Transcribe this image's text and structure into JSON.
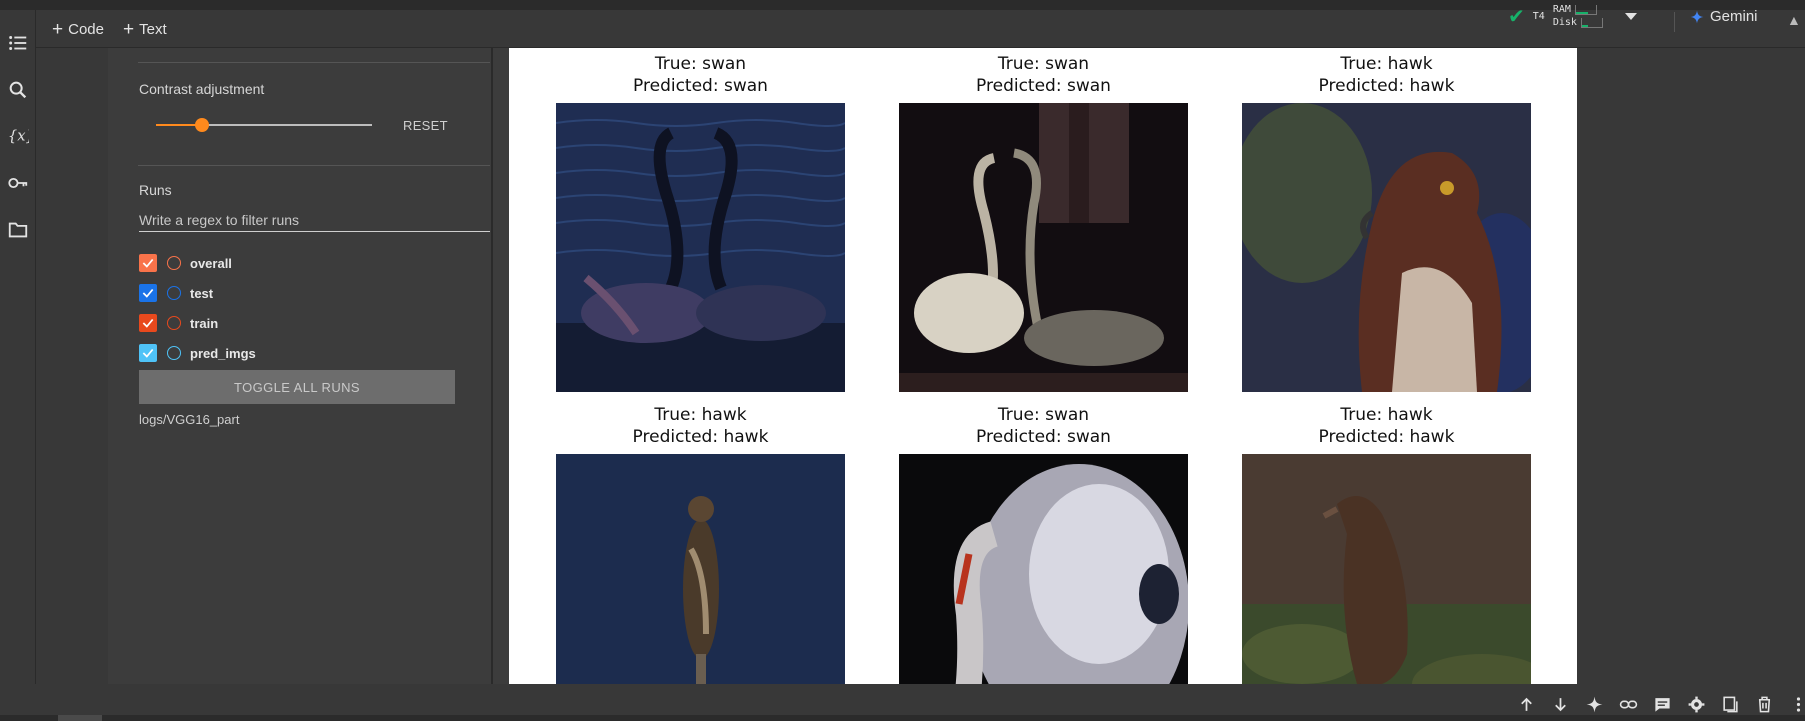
{
  "toolbar": {
    "code_label": "Code",
    "text_label": "Text",
    "gpu_label": "T4",
    "ram_label": "RAM",
    "disk_label": "Disk",
    "gemini_label": "Gemini"
  },
  "panel": {
    "contrast_label": "Contrast adjustment",
    "contrast_level": 0.2,
    "reset_label": "RESET",
    "runs_label": "Runs",
    "filter_placeholder": "Write a regex to filter runs",
    "runs": [
      {
        "name": "overall",
        "color": "#f9734a",
        "checked": true
      },
      {
        "name": "test",
        "color": "#1a73e8",
        "checked": true
      },
      {
        "name": "train",
        "color": "#e8491d",
        "checked": true
      },
      {
        "name": "pred_imgs",
        "color": "#4fc3f7",
        "checked": true
      }
    ],
    "toggle_label": "TOGGLE ALL RUNS",
    "logdir": "logs/VGG16_part"
  },
  "predictions": [
    {
      "true_label": "True: swan",
      "pred_label": "Predicted: swan"
    },
    {
      "true_label": "True: swan",
      "pred_label": "Predicted: swan"
    },
    {
      "true_label": "True: hawk",
      "pred_label": "Predicted: hawk"
    },
    {
      "true_label": "True: hawk",
      "pred_label": "Predicted: hawk"
    },
    {
      "true_label": "True: swan",
      "pred_label": "Predicted: swan"
    },
    {
      "true_label": "True: hawk",
      "pred_label": "Predicted: hawk"
    }
  ],
  "colors": {
    "accent": "#ff8a1d",
    "status_ok": "#17b26a",
    "gemini_star": "#4285f4"
  },
  "icons": {
    "rail": [
      "table-of-contents-icon",
      "search-icon",
      "variables-icon",
      "secrets-key-icon",
      "files-folder-icon",
      "code-snippets-icon"
    ],
    "bottom": [
      "move-up-icon",
      "move-down-icon",
      "gemini-sparkle-icon",
      "link-icon",
      "comment-icon",
      "settings-gear-icon",
      "mirror-cell-icon",
      "delete-icon",
      "more-vert-icon"
    ]
  }
}
